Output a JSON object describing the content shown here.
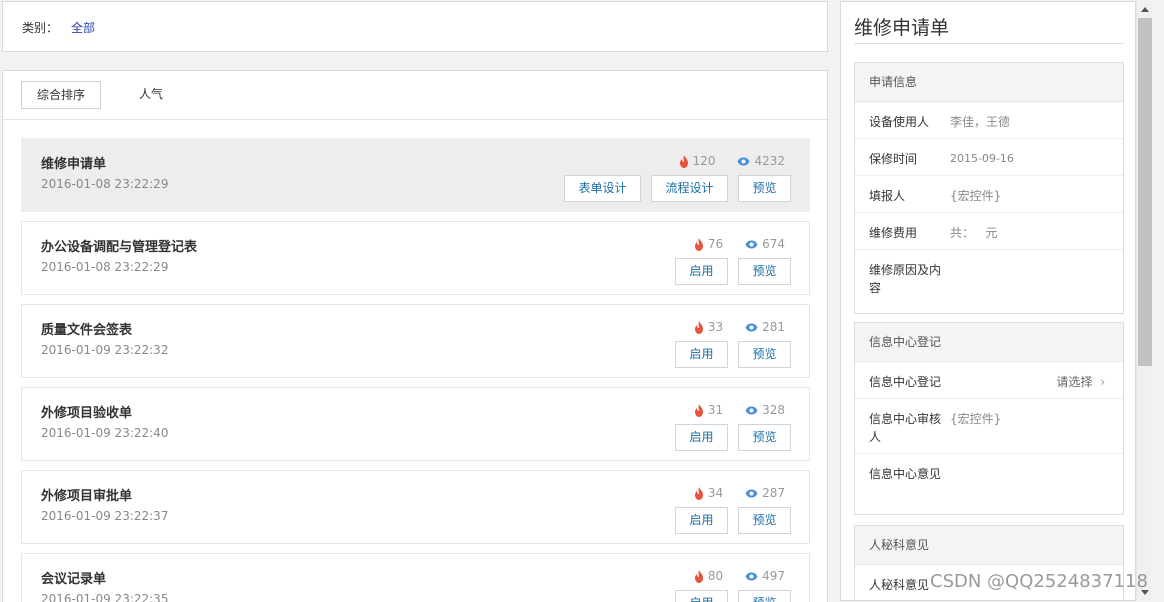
{
  "category": {
    "label": "类别：",
    "value": "全部"
  },
  "sort_tabs": [
    {
      "label": "综合排序",
      "active": true
    },
    {
      "label": "人气",
      "active": false
    }
  ],
  "forms": [
    {
      "title": "维修申请单",
      "date": "2016-01-08 23:22:29",
      "hot": "120",
      "views": "4232",
      "selected": true,
      "buttons": [
        "表单设计",
        "流程设计",
        "预览"
      ]
    },
    {
      "title": "办公设备调配与管理登记表",
      "date": "2016-01-08 23:22:29",
      "hot": "76",
      "views": "674",
      "selected": false,
      "buttons": [
        "启用",
        "预览"
      ]
    },
    {
      "title": "质量文件会签表",
      "date": "2016-01-09 23:22:32",
      "hot": "33",
      "views": "281",
      "selected": false,
      "buttons": [
        "启用",
        "预览"
      ]
    },
    {
      "title": "外修项目验收单",
      "date": "2016-01-09 23:22:40",
      "hot": "31",
      "views": "328",
      "selected": false,
      "buttons": [
        "启用",
        "预览"
      ]
    },
    {
      "title": "外修项目审批单",
      "date": "2016-01-09 23:22:37",
      "hot": "34",
      "views": "287",
      "selected": false,
      "buttons": [
        "启用",
        "预览"
      ]
    },
    {
      "title": "会议记录单",
      "date": "2016-01-09 23:22:35",
      "hot": "80",
      "views": "497",
      "selected": false,
      "buttons": [
        "启用",
        "预览"
      ]
    }
  ],
  "detail": {
    "title": "维修申请单",
    "sections": [
      {
        "header": "申请信息",
        "fields": [
          {
            "label": "设备使用人",
            "value": "李佳，王德"
          },
          {
            "label": "保修时间",
            "value": "2015-09-16"
          },
          {
            "label": "填报人",
            "value": "{宏控件}"
          },
          {
            "label": "维修费用",
            "value": "共：   元"
          },
          {
            "label": "维修原因及内容",
            "value": ""
          }
        ]
      },
      {
        "header": "信息中心登记",
        "fields": [
          {
            "label": "信息中心登记",
            "value": "",
            "picker": "请选择"
          },
          {
            "label": "信息中心审核人",
            "value": "{宏控件}"
          },
          {
            "label": "信息中心意见",
            "value": ""
          }
        ]
      },
      {
        "header": "人秘科意见",
        "fields": [
          {
            "label": "人秘科意见",
            "value": ""
          }
        ]
      }
    ]
  },
  "watermark": "CSDN @QQ2524837118",
  "colors": {
    "accent_link": "#2b3fb3",
    "button_text": "#1a6fa6",
    "hot_icon": "#e8533b",
    "view_icon": "#4a90d9"
  },
  "icons": {
    "hot": "fire-icon",
    "views": "eye-icon",
    "picker": "chevron-right-icon"
  }
}
